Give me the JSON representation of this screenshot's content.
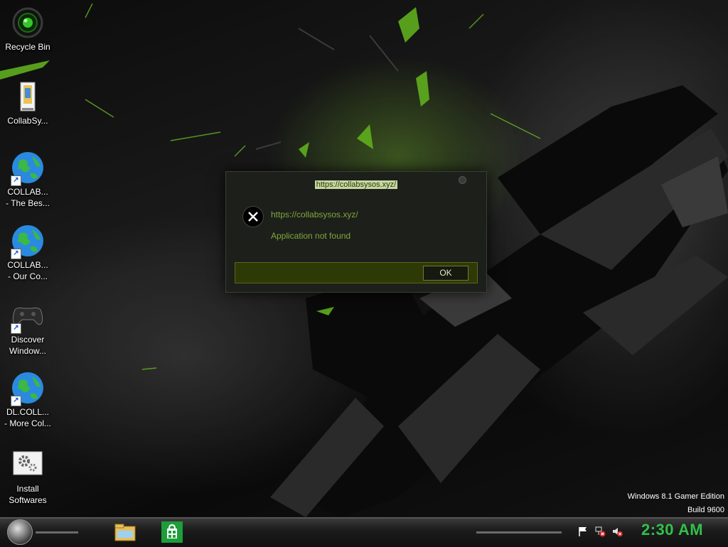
{
  "desktop": {
    "icons": [
      {
        "label": "Recycle Bin",
        "icon": "recycle-bin-icon"
      },
      {
        "label": "CollabSy...",
        "icon": "folder-icon"
      },
      {
        "label_line1": "COLLAB...",
        "label_line2": "- The Bes...",
        "icon": "globe-icon",
        "shortcut": true
      },
      {
        "label_line1": "COLLAB...",
        "label_line2": "- Our Co...",
        "icon": "globe-icon",
        "shortcut": true
      },
      {
        "label_line1": "Discover",
        "label_line2": "Window...",
        "icon": "gamepad-icon",
        "shortcut": true
      },
      {
        "label_line1": "DL.COLL...",
        "label_line2": "- More Col...",
        "icon": "globe-icon",
        "shortcut": true
      },
      {
        "label_line1": "Install",
        "label_line2": "Softwares",
        "icon": "gears-icon"
      }
    ]
  },
  "dialog": {
    "title": "https://collabsysos.xyz/",
    "url": "https://collabsysos.xyz/",
    "message": "Application not found",
    "ok_label": "OK",
    "icon": "error-x-icon"
  },
  "branding": {
    "edition": "Windows 8.1 Gamer Edition",
    "build": "Build 9600"
  },
  "taskbar": {
    "start": "start-orb-icon",
    "apps": [
      "file-explorer-icon",
      "store-icon"
    ],
    "tray": [
      "flag-icon",
      "network-error-icon",
      "volume-muted-icon"
    ],
    "clock": "2:30 AM",
    "clock_color": "#31c14a"
  },
  "colors": {
    "accent_green": "#7fa83a",
    "dialog_bar": "#2e3a06"
  }
}
